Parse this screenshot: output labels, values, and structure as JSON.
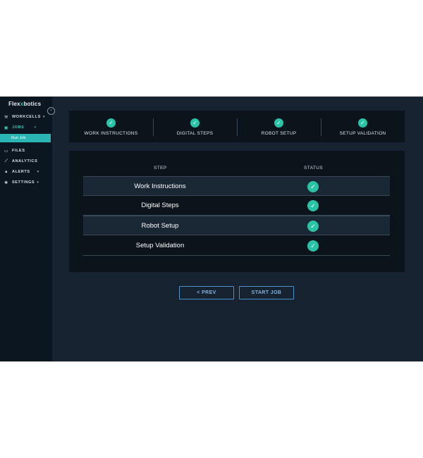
{
  "sidebar": {
    "brand_prefix": "Flex",
    "brand_accent": "x",
    "brand_suffix": "botics",
    "collapse_glyph": "‹",
    "items": [
      {
        "label": "WORKCELLS",
        "icon": "▾",
        "has_chevron": true
      },
      {
        "label": "JOBS",
        "has_chevron": true,
        "active": true
      },
      {
        "label": "FILES"
      },
      {
        "label": "ANALYTICS"
      },
      {
        "label": "ALERTS",
        "has_chevron": true
      },
      {
        "label": "SETTINGS",
        "has_chevron": true
      }
    ],
    "sub_item": "Run Job"
  },
  "stepper": {
    "steps": [
      "WORK INSTRUCTIONS",
      "DIGITAL STEPS",
      "ROBOT SETUP",
      "SETUP VALIDATION"
    ]
  },
  "table": {
    "headers": {
      "step": "STEP",
      "status": "STATUS"
    },
    "rows": [
      {
        "step": "Work Instructions",
        "status": "complete"
      },
      {
        "step": "Digital Steps",
        "status": "complete"
      },
      {
        "step": "Robot Setup",
        "status": "complete"
      },
      {
        "step": "Setup Validation",
        "status": "complete"
      }
    ]
  },
  "buttons": {
    "prev": "< PREV",
    "start": "START JOB"
  },
  "colors": {
    "accent": "#29c3a7",
    "active_nav": "#2ab5b2",
    "button_border": "#4a90c8"
  }
}
